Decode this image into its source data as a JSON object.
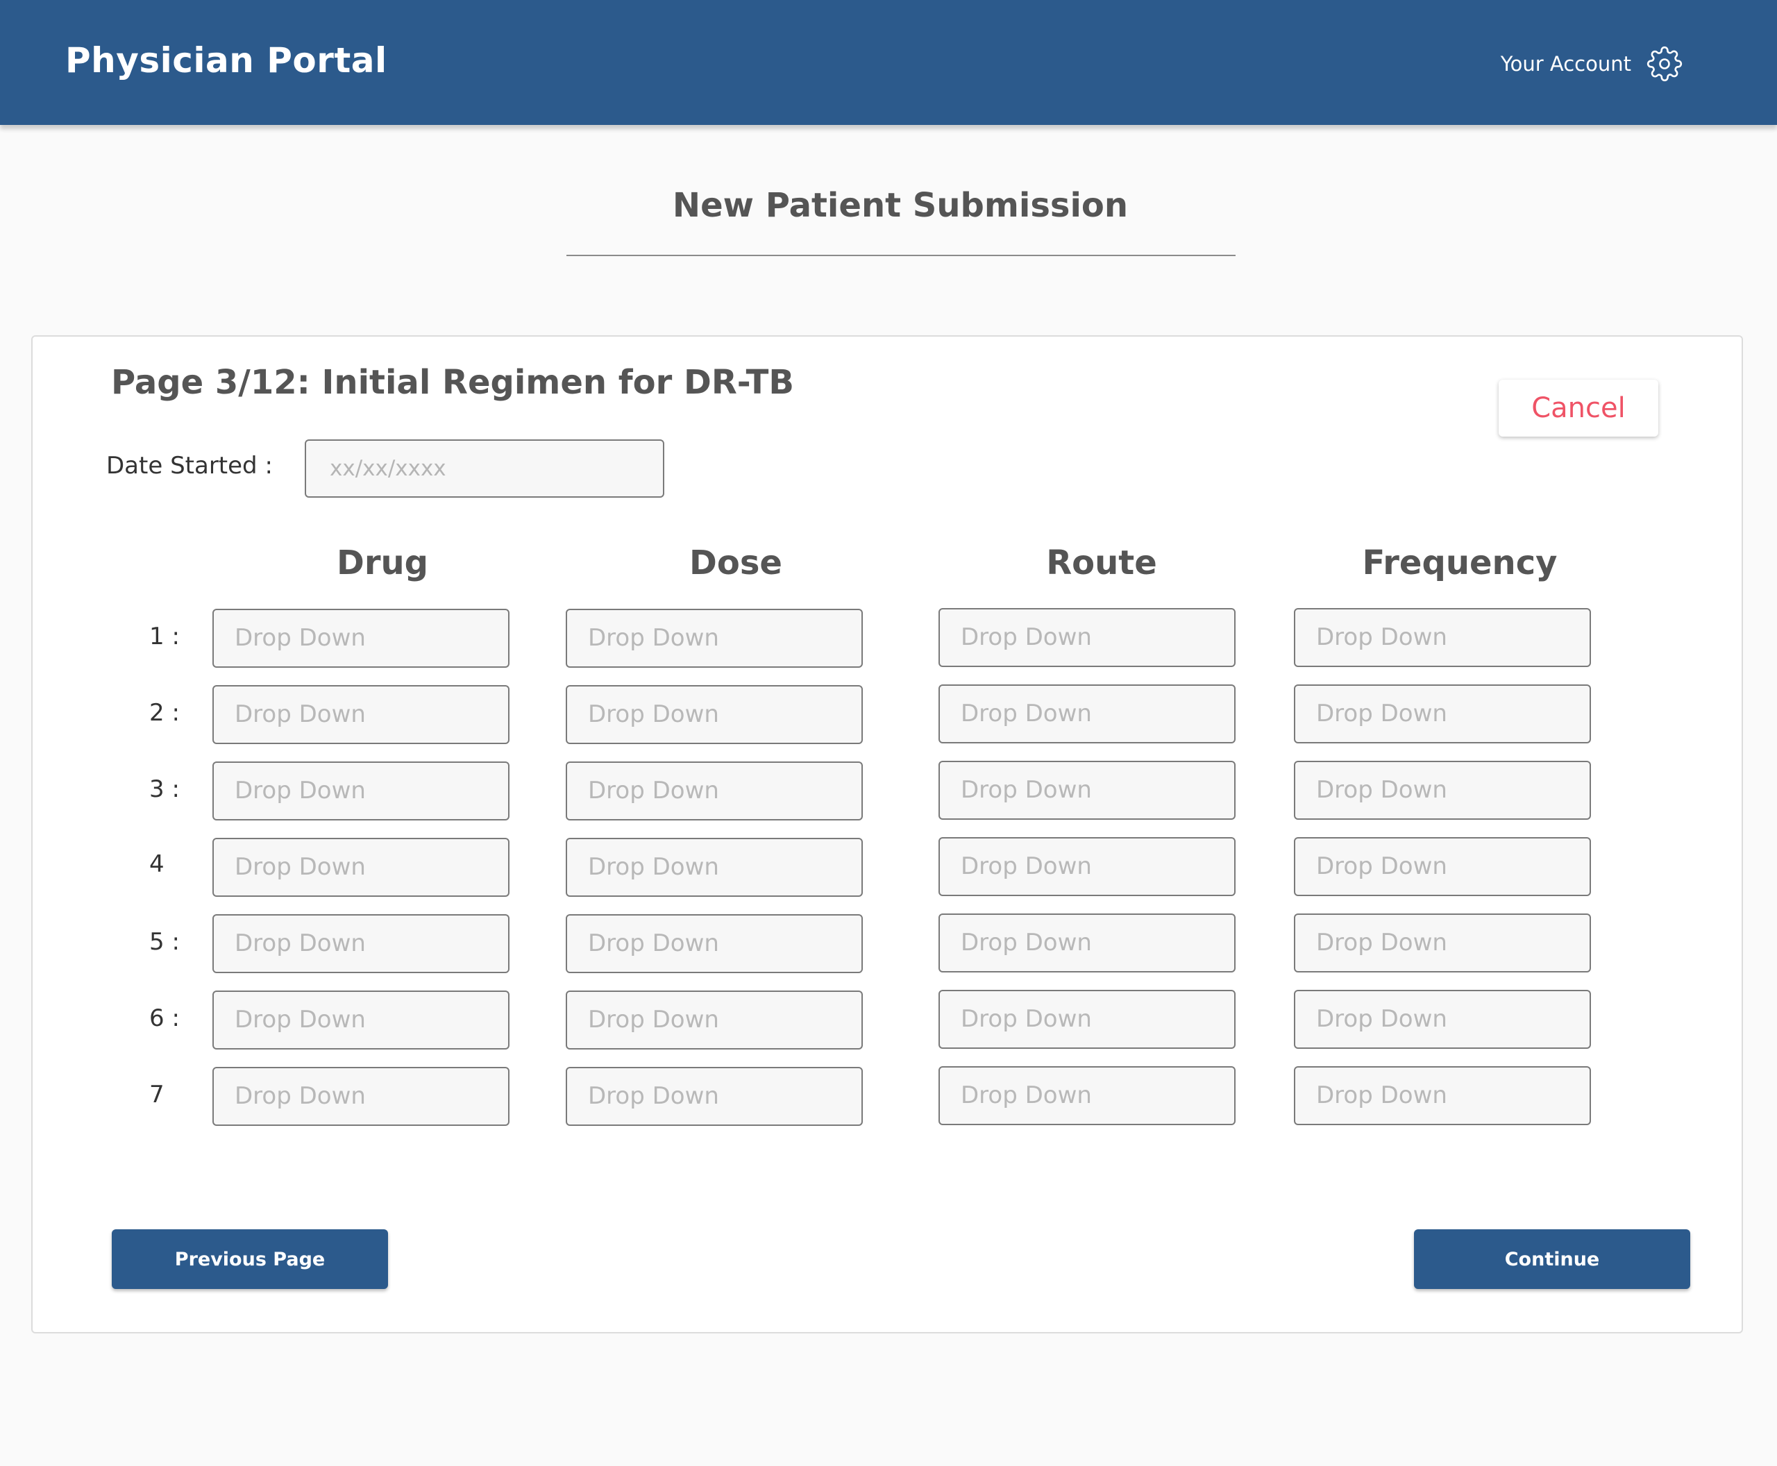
{
  "header": {
    "brand": "Physician Portal",
    "account_label": "Your Account",
    "account_icon": "gear-icon",
    "background_color": "#2c5a8c"
  },
  "page": {
    "title": "New Patient Submission"
  },
  "form": {
    "section_title": "Page 3/12: Initial Regimen for DR-TB",
    "cancel_label": "Cancel",
    "date_label": "Date Started :",
    "date_placeholder": "xx/xx/xxxx",
    "date_value": "",
    "columns": [
      "Drug",
      "Dose",
      "Route",
      "Frequency"
    ],
    "row_labels": [
      "1 :",
      "2 :",
      "3 :",
      "4",
      "5 :",
      "6 :",
      "7"
    ],
    "dropdown_placeholder": "Drop Down",
    "previous_label": "Previous Page",
    "continue_label": "Continue",
    "cancel_color": "#ef5366",
    "accent_color": "#2c5a8c"
  }
}
